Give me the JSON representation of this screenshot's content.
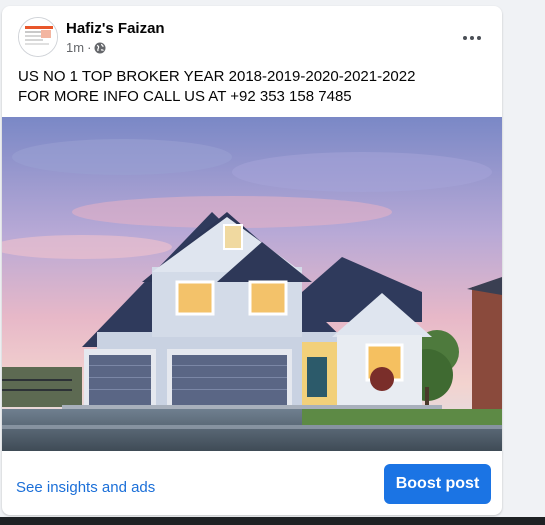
{
  "post": {
    "author": "Hafiz's Faizan",
    "time": "1m",
    "separator": "·",
    "visibility_icon": "globe-icon",
    "more_icon": "ellipsis-icon",
    "text_line1": "US NO 1 TOP BROKER YEAR 2018-2019-2020-2021-2022",
    "text_line2": "FOR MORE INFO CALL US AT +92 353 158 7485"
  },
  "footer": {
    "insights_label": "See insights and ads",
    "boost_label": "Boost post"
  },
  "colors": {
    "accent": "#1b74e4",
    "link": "#1b6fd8",
    "secondary_text": "#65676b"
  }
}
